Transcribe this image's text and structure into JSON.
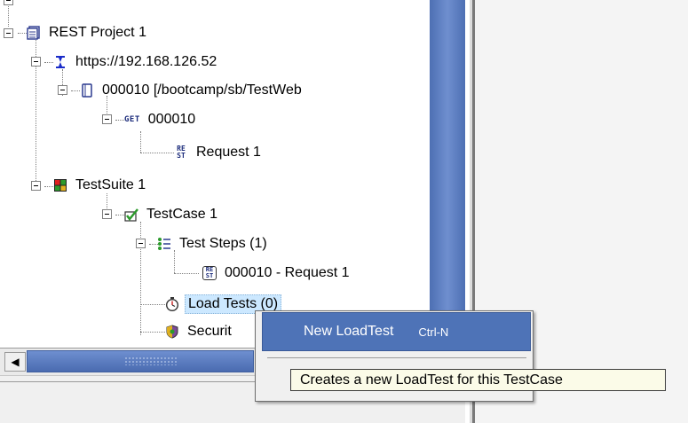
{
  "tree": {
    "project": "REST Project 1",
    "endpoint": "https://192.168.126.52",
    "resource": "000010 [/bootcamp/sb/TestWeb",
    "method": "000010",
    "method_badge": "GET",
    "request": "Request 1",
    "rest_badge_top": "RE",
    "rest_badge_bottom": "ST",
    "testsuite": "TestSuite 1",
    "testcase": "TestCase 1",
    "teststeps": "Test Steps (1)",
    "teststep_item": "000010 - Request 1",
    "loadtests": "Load Tests (0)",
    "security": "Securit"
  },
  "context_menu": {
    "item_label": "New LoadTest",
    "item_shortcut": "Ctrl-N"
  },
  "tooltip": "Creates a new LoadTest for this TestCase",
  "scrollbar": {
    "left_arrow": "◀"
  },
  "colors": {
    "selection": "#cce8ff",
    "menu_highlight": "#4e73b7",
    "scroll_thumb": "#5b7dbf",
    "tooltip_bg": "#fbfbe8"
  },
  "icons": [
    "project-icon",
    "endpoint-icon",
    "resource-icon",
    "get-method-icon",
    "rest-request-icon",
    "testsuite-icon",
    "testcase-icon",
    "teststeps-icon",
    "teststep-request-icon",
    "stopwatch-icon",
    "security-shield-icon"
  ]
}
